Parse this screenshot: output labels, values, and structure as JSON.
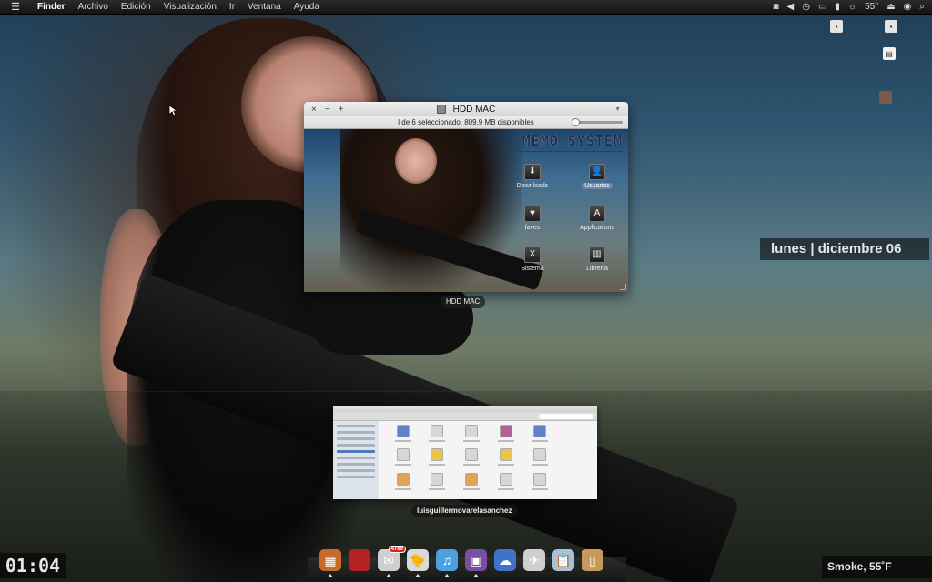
{
  "menubar": {
    "items": [
      "Finder",
      "Archivo",
      "Edición",
      "Visualización",
      "Ir",
      "Ventana",
      "Ayuda"
    ],
    "temperature": "55°"
  },
  "finder_window": {
    "title": "HDD MAC",
    "status": "l de 6 seleccionado, 809.9 MB disponibles",
    "logo": "MEMO SYSTEM",
    "items": [
      {
        "label": "Downloads",
        "icon": "downloads-folder-icon",
        "glyph": "⬇"
      },
      {
        "label": "Usuarios",
        "icon": "users-folder-icon",
        "glyph": "👤",
        "selected": true
      },
      {
        "label": "faves",
        "icon": "faves-folder-icon",
        "glyph": "♥"
      },
      {
        "label": "Applications",
        "icon": "applications-folder-icon",
        "glyph": "A"
      },
      {
        "label": "Sistema",
        "icon": "system-folder-icon",
        "glyph": "X"
      },
      {
        "label": "Librería",
        "icon": "library-folder-icon",
        "glyph": "▥"
      }
    ],
    "tag": "HDD MAC"
  },
  "mini_window": {
    "owner": "luisguillermovarelasanchez"
  },
  "widgets": {
    "date": "lunes | diciembre 06",
    "clock": "01:04",
    "weather": "Smoke, 55˚F"
  },
  "dock": {
    "mail_badge": "4789",
    "items": [
      {
        "icon": "finder-dock-icon",
        "glyph": "▦",
        "color": "#c76a2a",
        "running": true
      },
      {
        "icon": "apple-dock-icon",
        "glyph": "",
        "color": "#b52020",
        "running": false
      },
      {
        "icon": "mail-dock-icon",
        "glyph": "✉",
        "color": "#cfcfcf",
        "running": true,
        "badge": true
      },
      {
        "icon": "adium-dock-icon",
        "glyph": "🐤",
        "color": "#d9d9d9",
        "running": true
      },
      {
        "icon": "itunes-dock-icon",
        "glyph": "♫",
        "color": "#4aa0e0",
        "running": true
      },
      {
        "icon": "photo-dock-icon",
        "glyph": "▣",
        "color": "#7b4fa0",
        "running": true
      },
      {
        "icon": "cloud-dock-icon",
        "glyph": "☁",
        "color": "#3d73c8",
        "running": false
      },
      {
        "icon": "maps-dock-icon",
        "glyph": "✈",
        "color": "#cfcfcf",
        "running": false
      },
      {
        "icon": "clipboard-dock-icon",
        "glyph": "📋",
        "color": "#aac0d8",
        "running": false
      },
      {
        "icon": "trash-dock-icon",
        "glyph": "▯",
        "color": "#c69a5a",
        "running": false
      }
    ]
  }
}
